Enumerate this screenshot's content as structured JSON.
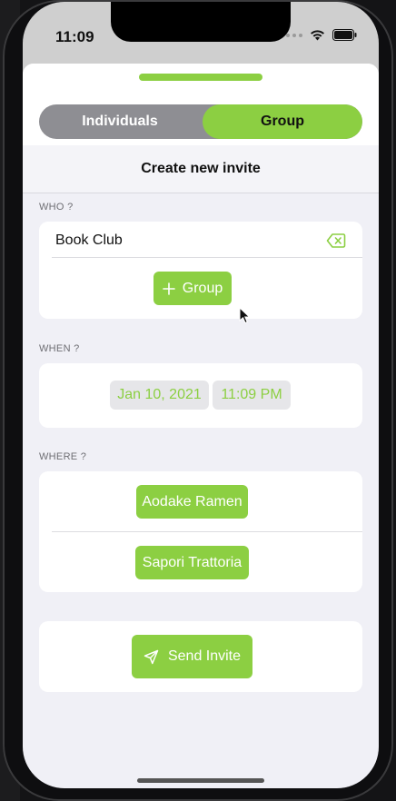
{
  "status_bar": {
    "time": "11:09"
  },
  "segment": {
    "individuals": "Individuals",
    "group": "Group"
  },
  "nav": {
    "title": "Create new invite"
  },
  "who": {
    "label": "WHO ?",
    "group_name": "Book Club",
    "add_group_button": "Group"
  },
  "when": {
    "label": "WHEN ?",
    "date": "Jan 10, 2021",
    "time": "11:09 PM"
  },
  "where": {
    "label": "WHERE ?",
    "places": [
      "Aodake Ramen",
      "Sapori Trattoria"
    ]
  },
  "send": {
    "label": "Send Invite"
  },
  "colors": {
    "accent": "#8ccf42",
    "segment_bg": "#8e8e93",
    "sheet_bg": "#f0f0f6"
  }
}
